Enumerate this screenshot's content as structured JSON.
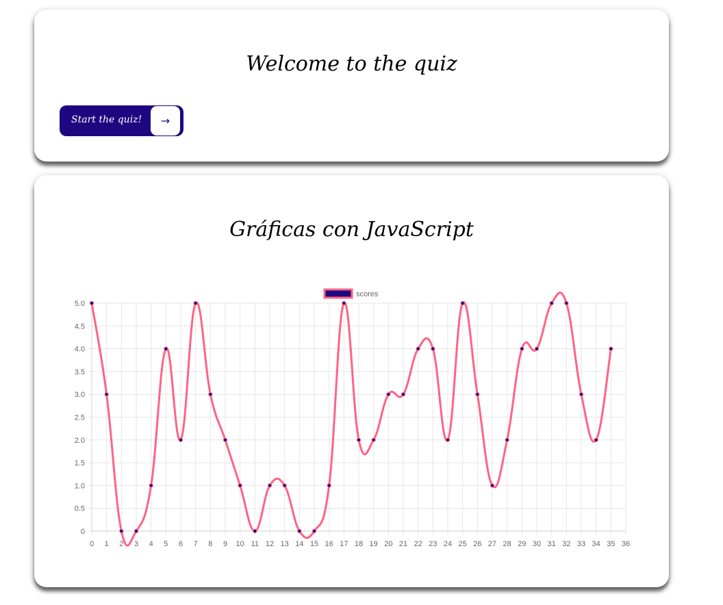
{
  "quiz_card": {
    "title": "Welcome to the quiz",
    "start_button_label": "Start the quiz!",
    "start_button_icon": "arrow-right-icon"
  },
  "chart_card": {
    "title": "Gráficas con JavaScript"
  },
  "colors": {
    "button_bg": "#1e0680",
    "line": "#ff6384",
    "point": "#1e0680"
  },
  "chart_data": {
    "type": "line",
    "x": [
      0,
      1,
      2,
      3,
      4,
      5,
      6,
      7,
      8,
      9,
      10,
      11,
      12,
      13,
      14,
      15,
      16,
      17,
      18,
      19,
      20,
      21,
      22,
      23,
      24,
      25,
      26,
      27,
      28,
      29,
      30,
      31,
      32,
      33,
      34,
      35
    ],
    "series": [
      {
        "name": "scores",
        "values": [
          5,
          3,
          0,
          0,
          1,
          4,
          2,
          5,
          3,
          2,
          1,
          0,
          1,
          1,
          0,
          0,
          1,
          5,
          2,
          2,
          3,
          3,
          4,
          4,
          2,
          5,
          3,
          1,
          2,
          4,
          4,
          5,
          5,
          3,
          2,
          4
        ]
      }
    ],
    "xlim": [
      0,
      36
    ],
    "ylim": [
      0,
      5
    ],
    "x_ticks": [
      0,
      1,
      2,
      3,
      4,
      5,
      6,
      7,
      8,
      9,
      10,
      11,
      12,
      13,
      14,
      15,
      16,
      17,
      18,
      19,
      20,
      21,
      22,
      23,
      24,
      25,
      26,
      27,
      28,
      29,
      30,
      31,
      32,
      33,
      34,
      35,
      36
    ],
    "y_ticks": [
      "0",
      "0.5",
      "1.0",
      "1.5",
      "2.0",
      "2.5",
      "3.0",
      "3.5",
      "4.0",
      "4.5",
      "5.0"
    ],
    "legend_position": "top",
    "grid": true,
    "smooth": true
  }
}
